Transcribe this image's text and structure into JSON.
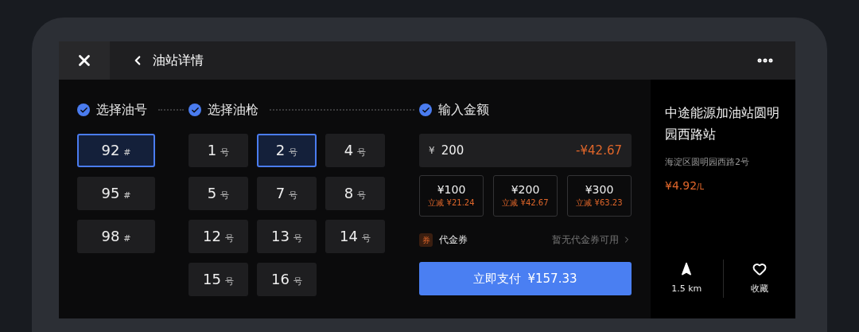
{
  "header": {
    "title": "油站详情"
  },
  "steps": [
    {
      "label": "选择油号",
      "checked": true
    },
    {
      "label": "选择油枪",
      "checked": true
    },
    {
      "label": "输入金额",
      "checked": true
    }
  ],
  "fuel_types": [
    {
      "label": "92",
      "unit": "#",
      "selected": true
    },
    {
      "label": "95",
      "unit": "#",
      "selected": false
    },
    {
      "label": "98",
      "unit": "#",
      "selected": false
    }
  ],
  "nozzles": [
    {
      "label": "1",
      "unit": "号",
      "selected": false
    },
    {
      "label": "2",
      "unit": "号",
      "selected": true
    },
    {
      "label": "4",
      "unit": "号",
      "selected": false
    },
    {
      "label": "5",
      "unit": "号",
      "selected": false
    },
    {
      "label": "7",
      "unit": "号",
      "selected": false
    },
    {
      "label": "8",
      "unit": "号",
      "selected": false
    },
    {
      "label": "12",
      "unit": "号",
      "selected": false
    },
    {
      "label": "13",
      "unit": "号",
      "selected": false
    },
    {
      "label": "14",
      "unit": "号",
      "selected": false
    },
    {
      "label": "15",
      "unit": "号",
      "selected": false
    },
    {
      "label": "16",
      "unit": "号",
      "selected": false
    }
  ],
  "amount": {
    "currency": "¥",
    "value": "200",
    "discount": "-¥42.67"
  },
  "presets": [
    {
      "amount": "¥100",
      "discount": "立减 ¥21.24"
    },
    {
      "amount": "¥200",
      "discount": "立减 ¥42.67"
    },
    {
      "amount": "¥300",
      "discount": "立减 ¥63.23"
    }
  ],
  "coupon": {
    "badge": "券",
    "label": "代金券",
    "status": "暂无代金券可用"
  },
  "pay_button": {
    "label": "立即支付",
    "amount": "¥157.33"
  },
  "station": {
    "name": "中途能源加油站圆明园西路站",
    "address": "海淀区圆明园西路2号",
    "price": "¥4.92",
    "price_unit": "/L",
    "distance": "1.5 km",
    "favorite": "收藏"
  }
}
